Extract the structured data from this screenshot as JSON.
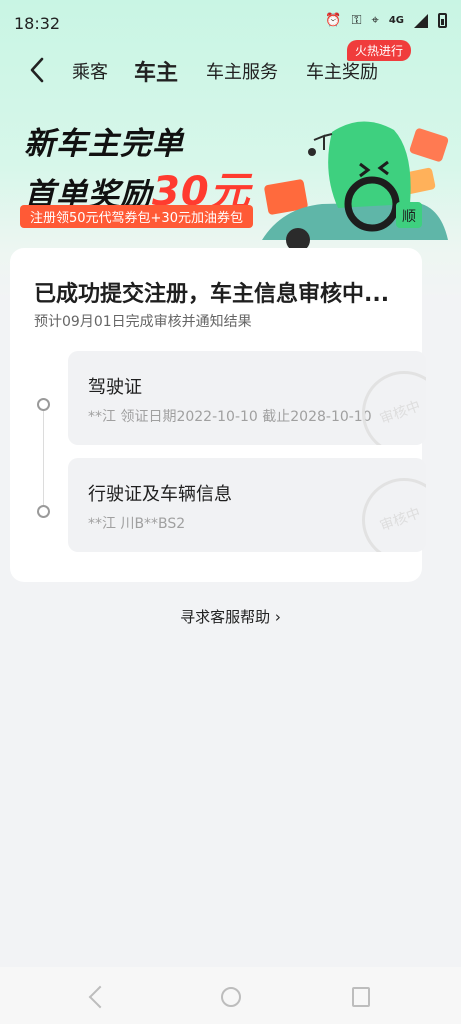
{
  "status_bar": {
    "time": "18:32",
    "network": "4G"
  },
  "nav": {
    "tabs": [
      {
        "label": "乘客"
      },
      {
        "label": "车主"
      },
      {
        "label": "车主服务"
      },
      {
        "label": "车主奖励"
      }
    ],
    "active_tab": "车主",
    "hot_badge": "火热进行"
  },
  "banner": {
    "line1": "新车主完单",
    "line2_prefix": "首单奖励",
    "line2_amount": "30元",
    "subtitle": "注册领50元代驾券包+30元加油券包",
    "mascot_text": "顺"
  },
  "status_card": {
    "title": "已成功提交注册，车主信息审核中...",
    "subtitle": "预计09月01日完成审核并通知结果",
    "items": [
      {
        "title": "驾驶证",
        "detail": "**江 领证日期2022-10-10 截止2028-10-10",
        "stamp": "审核中"
      },
      {
        "title": "行驶证及车辆信息",
        "detail": "**江 川B**BS2",
        "stamp": "审核中"
      }
    ]
  },
  "help_link": "寻求客服帮助 ›",
  "colors": {
    "accent": "#4fd6a8",
    "badge": "#f03c3c",
    "reward": "#ff3b2f"
  }
}
